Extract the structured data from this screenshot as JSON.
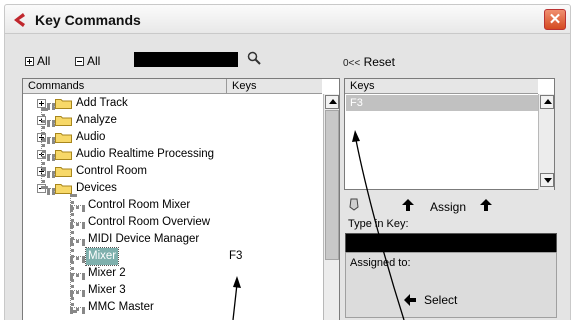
{
  "window": {
    "title": "Key Commands",
    "close_glyph": "✕"
  },
  "toolbar": {
    "expand_all_label": "All",
    "collapse_all_label": "All",
    "search_value": "",
    "reset_label": "Reset",
    "reset_glyph": "0<<"
  },
  "commands_panel": {
    "header_commands": "Commands",
    "header_keys": "Keys",
    "rows": [
      {
        "label": "Add Track",
        "keys": "",
        "type": "folder",
        "expanded": false
      },
      {
        "label": "Analyze",
        "keys": "",
        "type": "folder",
        "expanded": false
      },
      {
        "label": "Audio",
        "keys": "",
        "type": "folder",
        "expanded": false
      },
      {
        "label": "Audio Realtime Processing",
        "keys": "",
        "type": "folder",
        "expanded": false
      },
      {
        "label": "Control Room",
        "keys": "",
        "type": "folder",
        "expanded": false
      },
      {
        "label": "Devices",
        "keys": "",
        "type": "folder",
        "expanded": true
      },
      {
        "label": "Control Room Mixer",
        "keys": "",
        "type": "command"
      },
      {
        "label": "Control Room Overview",
        "keys": "",
        "type": "command"
      },
      {
        "label": "MIDI Device Manager",
        "keys": "",
        "type": "command"
      },
      {
        "label": "Mixer",
        "keys": "F3",
        "type": "command",
        "selected": true
      },
      {
        "label": "Mixer 2",
        "keys": "",
        "type": "command"
      },
      {
        "label": "Mixer 3",
        "keys": "",
        "type": "command"
      },
      {
        "label": "MMC Master",
        "keys": "",
        "type": "command"
      }
    ]
  },
  "keys_panel": {
    "header": "Keys",
    "items": [
      "F3"
    ]
  },
  "assign": {
    "label": "Assign"
  },
  "type_in": {
    "label": "Type in Key:",
    "value": ""
  },
  "assigned_to": {
    "label": "Assigned to:",
    "select_label": "Select"
  },
  "colors": {
    "title_close": "#d44a22",
    "selection": "#7fb0ad",
    "keys_selected_bg": "#c1c1c1",
    "panel_bg": "#e4e4e4"
  }
}
